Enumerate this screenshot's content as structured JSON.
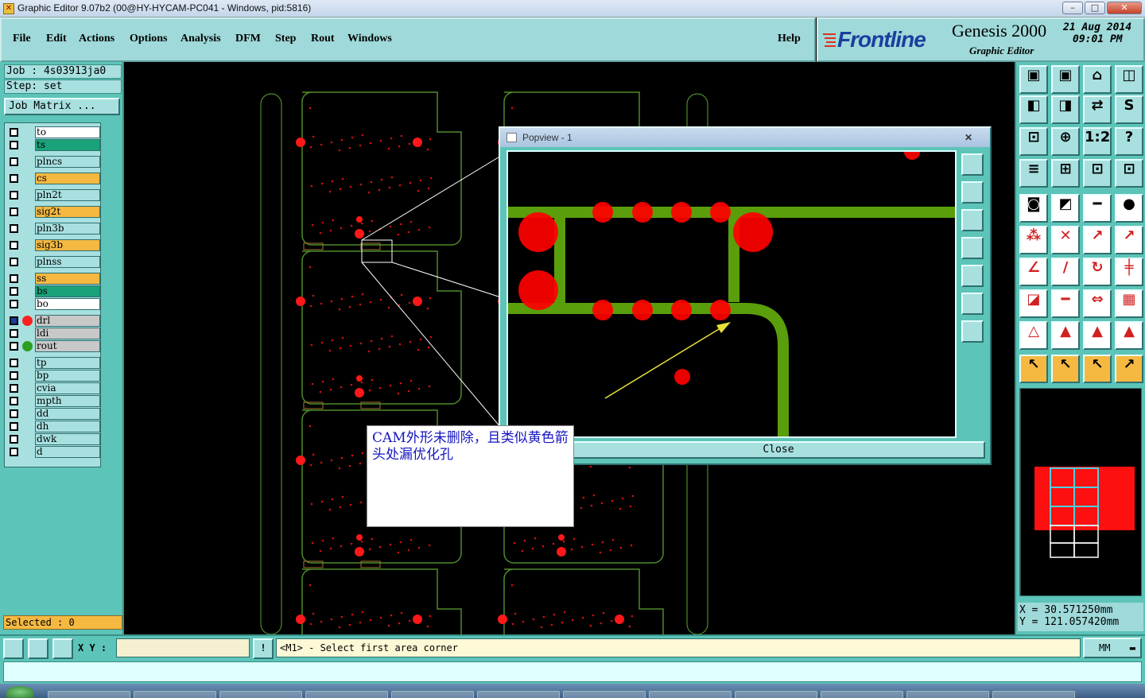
{
  "window": {
    "title": "Graphic Editor 9.07b2 (00@HY-HYCAM-PC041 - Windows, pid:5816)",
    "minimize": "–",
    "maximize": "□",
    "close": "✕"
  },
  "menu": {
    "file": "File",
    "edit": "Edit",
    "actions": "Actions",
    "options": "Options",
    "analysis": "Analysis",
    "dfm": "DFM",
    "step": "Step",
    "rout": "Rout",
    "windows": "Windows",
    "help": "Help"
  },
  "brand": {
    "logo": "Frontline",
    "product": "Genesis 2000",
    "subtitle": "Graphic Editor",
    "date": "21 Aug 2014",
    "time": "09:01 PM"
  },
  "job": {
    "job_line": "Job : 4s03913ja0",
    "step_line": "Step: set",
    "matrix_button": "Job Matrix ..."
  },
  "layers": [
    {
      "name": "to",
      "color": "#ffffff"
    },
    {
      "name": "ts",
      "color": "#1aa37a"
    },
    {
      "name": "plncs",
      "color": "#a8e0e0"
    },
    {
      "name": "cs",
      "color": "#f5b942"
    },
    {
      "name": "pln2t",
      "color": "#a8e0e0"
    },
    {
      "name": "sig2t",
      "color": "#f5b942"
    },
    {
      "name": "pln3b",
      "color": "#a8e0e0"
    },
    {
      "name": "sig3b",
      "color": "#f5b942"
    },
    {
      "name": "plnss",
      "color": "#a8e0e0"
    },
    {
      "name": "ss",
      "color": "#f5b942"
    },
    {
      "name": "bs",
      "color": "#1aa37a"
    },
    {
      "name": "bo",
      "color": "#ffffff"
    },
    {
      "name": "drl",
      "color": "#c8c8c8"
    },
    {
      "name": "ldi",
      "color": "#c8c8c8"
    },
    {
      "name": "rout",
      "color": "#c8c8c8"
    },
    {
      "name": "tp",
      "color": "#a8e0e0"
    },
    {
      "name": "bp",
      "color": "#a8e0e0"
    },
    {
      "name": "cvia",
      "color": "#a8e0e0"
    },
    {
      "name": "mpth",
      "color": "#a8e0e0"
    },
    {
      "name": "dd",
      "color": "#a8e0e0"
    },
    {
      "name": "dh",
      "color": "#a8e0e0"
    },
    {
      "name": "dwk",
      "color": "#a8e0e0"
    },
    {
      "name": "d",
      "color": "#a8e0e0"
    }
  ],
  "selected": "Selected : 0",
  "popview": {
    "title": "Popview - 1",
    "close_label": "Close",
    "close_x": "✕"
  },
  "annotation": {
    "text": "CAM外形未删除，且类似黄色箭头处漏优化孔"
  },
  "coords": {
    "x": "X = 30.571250mm",
    "y": "Y = 121.057420mm"
  },
  "command": {
    "xy_label": "X Y :",
    "prompt": "<M1> - Select first area corner",
    "units": "MM"
  },
  "colors": {
    "panel": "#5cc4b8",
    "trace": "#5a9e0c",
    "pad": "#ff0000",
    "outline": "#4d8a2a",
    "arrow": "#e6e13a"
  }
}
